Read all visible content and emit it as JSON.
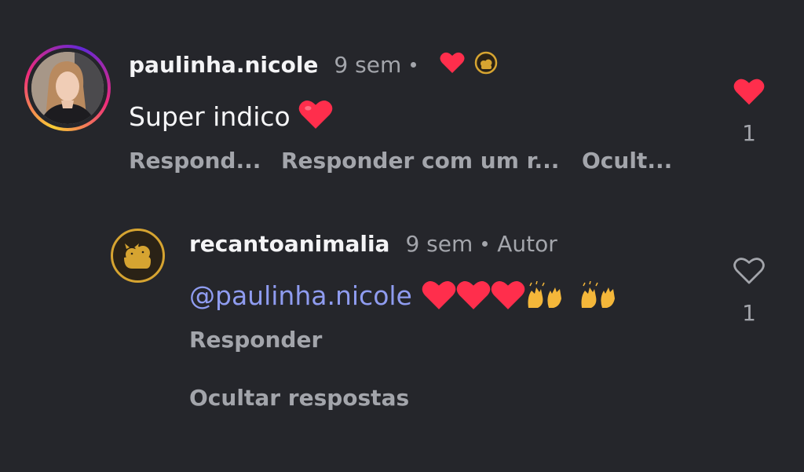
{
  "comment": {
    "username": "paulinha.nicole",
    "time": "9 sem",
    "text": "Super indico",
    "actions": {
      "reply": "Respond...",
      "reply_reel": "Responder com um r...",
      "hide": "Ocult..."
    },
    "like_count": "1",
    "liked": true,
    "author_liked_icon": "heart-icon"
  },
  "reply": {
    "username": "recantoanimalia",
    "time": "9 sem",
    "author_badge": "Autor",
    "mention": "@paulinha.nicole",
    "reply_action": "Responder",
    "like_count": "1",
    "liked": false
  },
  "hide_replies": "Ocultar respostas",
  "colors": {
    "background": "#25262b",
    "heart": "#ff2e4c",
    "mention": "#8f9cf0",
    "meta": "#a3a5ab",
    "brand_gold": "#d6a431"
  }
}
